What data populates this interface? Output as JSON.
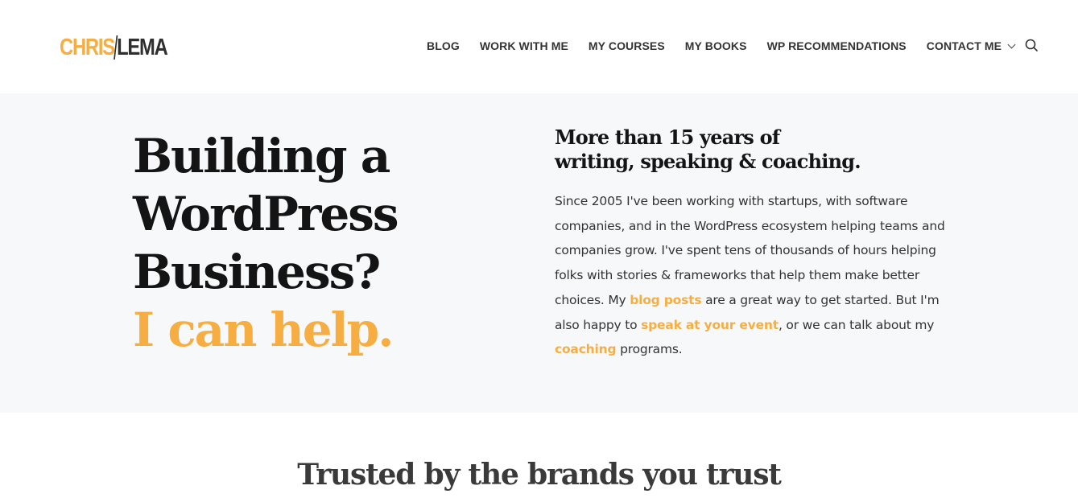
{
  "header": {
    "logo": {
      "first": "CHRIS",
      "second": "LEMA"
    },
    "nav": [
      {
        "label": "BLOG"
      },
      {
        "label": "WORK WITH ME"
      },
      {
        "label": "MY COURSES"
      },
      {
        "label": "MY BOOKS"
      },
      {
        "label": "WP RECOMMENDATIONS"
      },
      {
        "label": "CONTACT ME",
        "dropdown": true
      }
    ],
    "search_icon": "search-icon"
  },
  "hero": {
    "headline": [
      "Building a",
      "WordPress",
      "Business?"
    ],
    "headline_accent": "I can help.",
    "subhead": [
      "More than 15 years of",
      "writing, speaking & coaching."
    ],
    "body": {
      "part1": "Since 2005 I've been working with startups, with software companies, and in the WordPress ecosystem helping teams and companies grow. I've spent tens of thousands of hours helping folks with stories & frameworks that help them make better choices. My ",
      "link1": "blog posts",
      "part2": " are a great way to get started. But I'm also happy to ",
      "link2": "speak at your event",
      "part3": ", or we can talk about my ",
      "link3": "coaching",
      "part4": " programs."
    }
  },
  "trusted": {
    "title": "Trusted by the brands you trust"
  },
  "colors": {
    "accent": "#f6ae43",
    "hero_bg": "#f7f8f9",
    "text_dark": "#141414"
  }
}
